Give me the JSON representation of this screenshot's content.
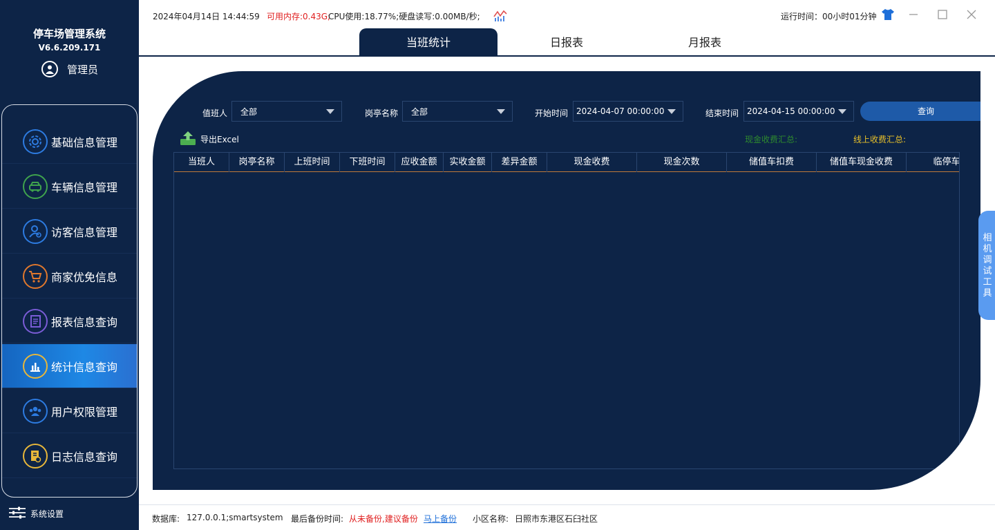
{
  "sidebar": {
    "title": "停车场管理系统",
    "version": "V6.6.209.171",
    "user": "管理员",
    "items": [
      {
        "label": "基础信息管理",
        "icon": "gear-icon",
        "color": "#2d7be0"
      },
      {
        "label": "车辆信息管理",
        "icon": "car-icon",
        "color": "#3fa34d"
      },
      {
        "label": "访客信息管理",
        "icon": "visitor-icon",
        "color": "#2d7be0"
      },
      {
        "label": "商家优免信息",
        "icon": "cart-icon",
        "color": "#e0782d"
      },
      {
        "label": "报表信息查询",
        "icon": "report-icon",
        "color": "#7a5cd6"
      },
      {
        "label": "统计信息查询",
        "icon": "chart-icon",
        "color": "#e8b73a"
      },
      {
        "label": "用户权限管理",
        "icon": "users-icon",
        "color": "#2d7be0"
      },
      {
        "label": "日志信息查询",
        "icon": "log-icon",
        "color": "#e8b73a"
      }
    ],
    "active_index": 5,
    "settings_label": "系统设置"
  },
  "topbar": {
    "datetime": "2024年04月14日 14:44:59",
    "memory": "可用内存:0.43G;",
    "cpu": "CPU使用:18.77%;硬盘读写:0.00MB/秒;",
    "runtime": "运行时间：00小时01分钟"
  },
  "tabs": [
    {
      "label": "当班统计",
      "active": true
    },
    {
      "label": "日报表",
      "active": false
    },
    {
      "label": "月报表",
      "active": false
    }
  ],
  "filters": {
    "duty_label": "值班人",
    "duty_value": "全部",
    "booth_label": "岗亭名称",
    "booth_value": "全部",
    "start_label": "开始时间",
    "start_value": "2024-04-07 00:00:00",
    "end_label": "结束时间",
    "end_value": "2024-04-15 00:00:00",
    "query_label": "查询"
  },
  "export_label": "导出Excel",
  "cash_summary": "现金收费汇总:",
  "online_summary": "线上收费汇总:",
  "table": {
    "headers": [
      "当班人",
      "岗亭名称",
      "上班时间",
      "下班时间",
      "应收金额",
      "实收金额",
      "差异金额",
      "现金收费",
      "现金次数",
      "储值车扣费",
      "储值车现金收费",
      "临停车收"
    ]
  },
  "side_tool": "相机调试工具",
  "bottom": {
    "db_label": "数据库:",
    "db_value": "127.0.0.1;smartsystem",
    "backup_label": "最后备份时间:",
    "backup_status": "从未备份,建议备份",
    "backup_link": "马上备份",
    "community_label": "小区名称:",
    "community_value": "日照市东港区石臼社区"
  },
  "colors": {
    "navy": "#0d2447",
    "active_nav": "#1e88e5",
    "warning": "#e02020",
    "link": "#1e6fd9"
  }
}
